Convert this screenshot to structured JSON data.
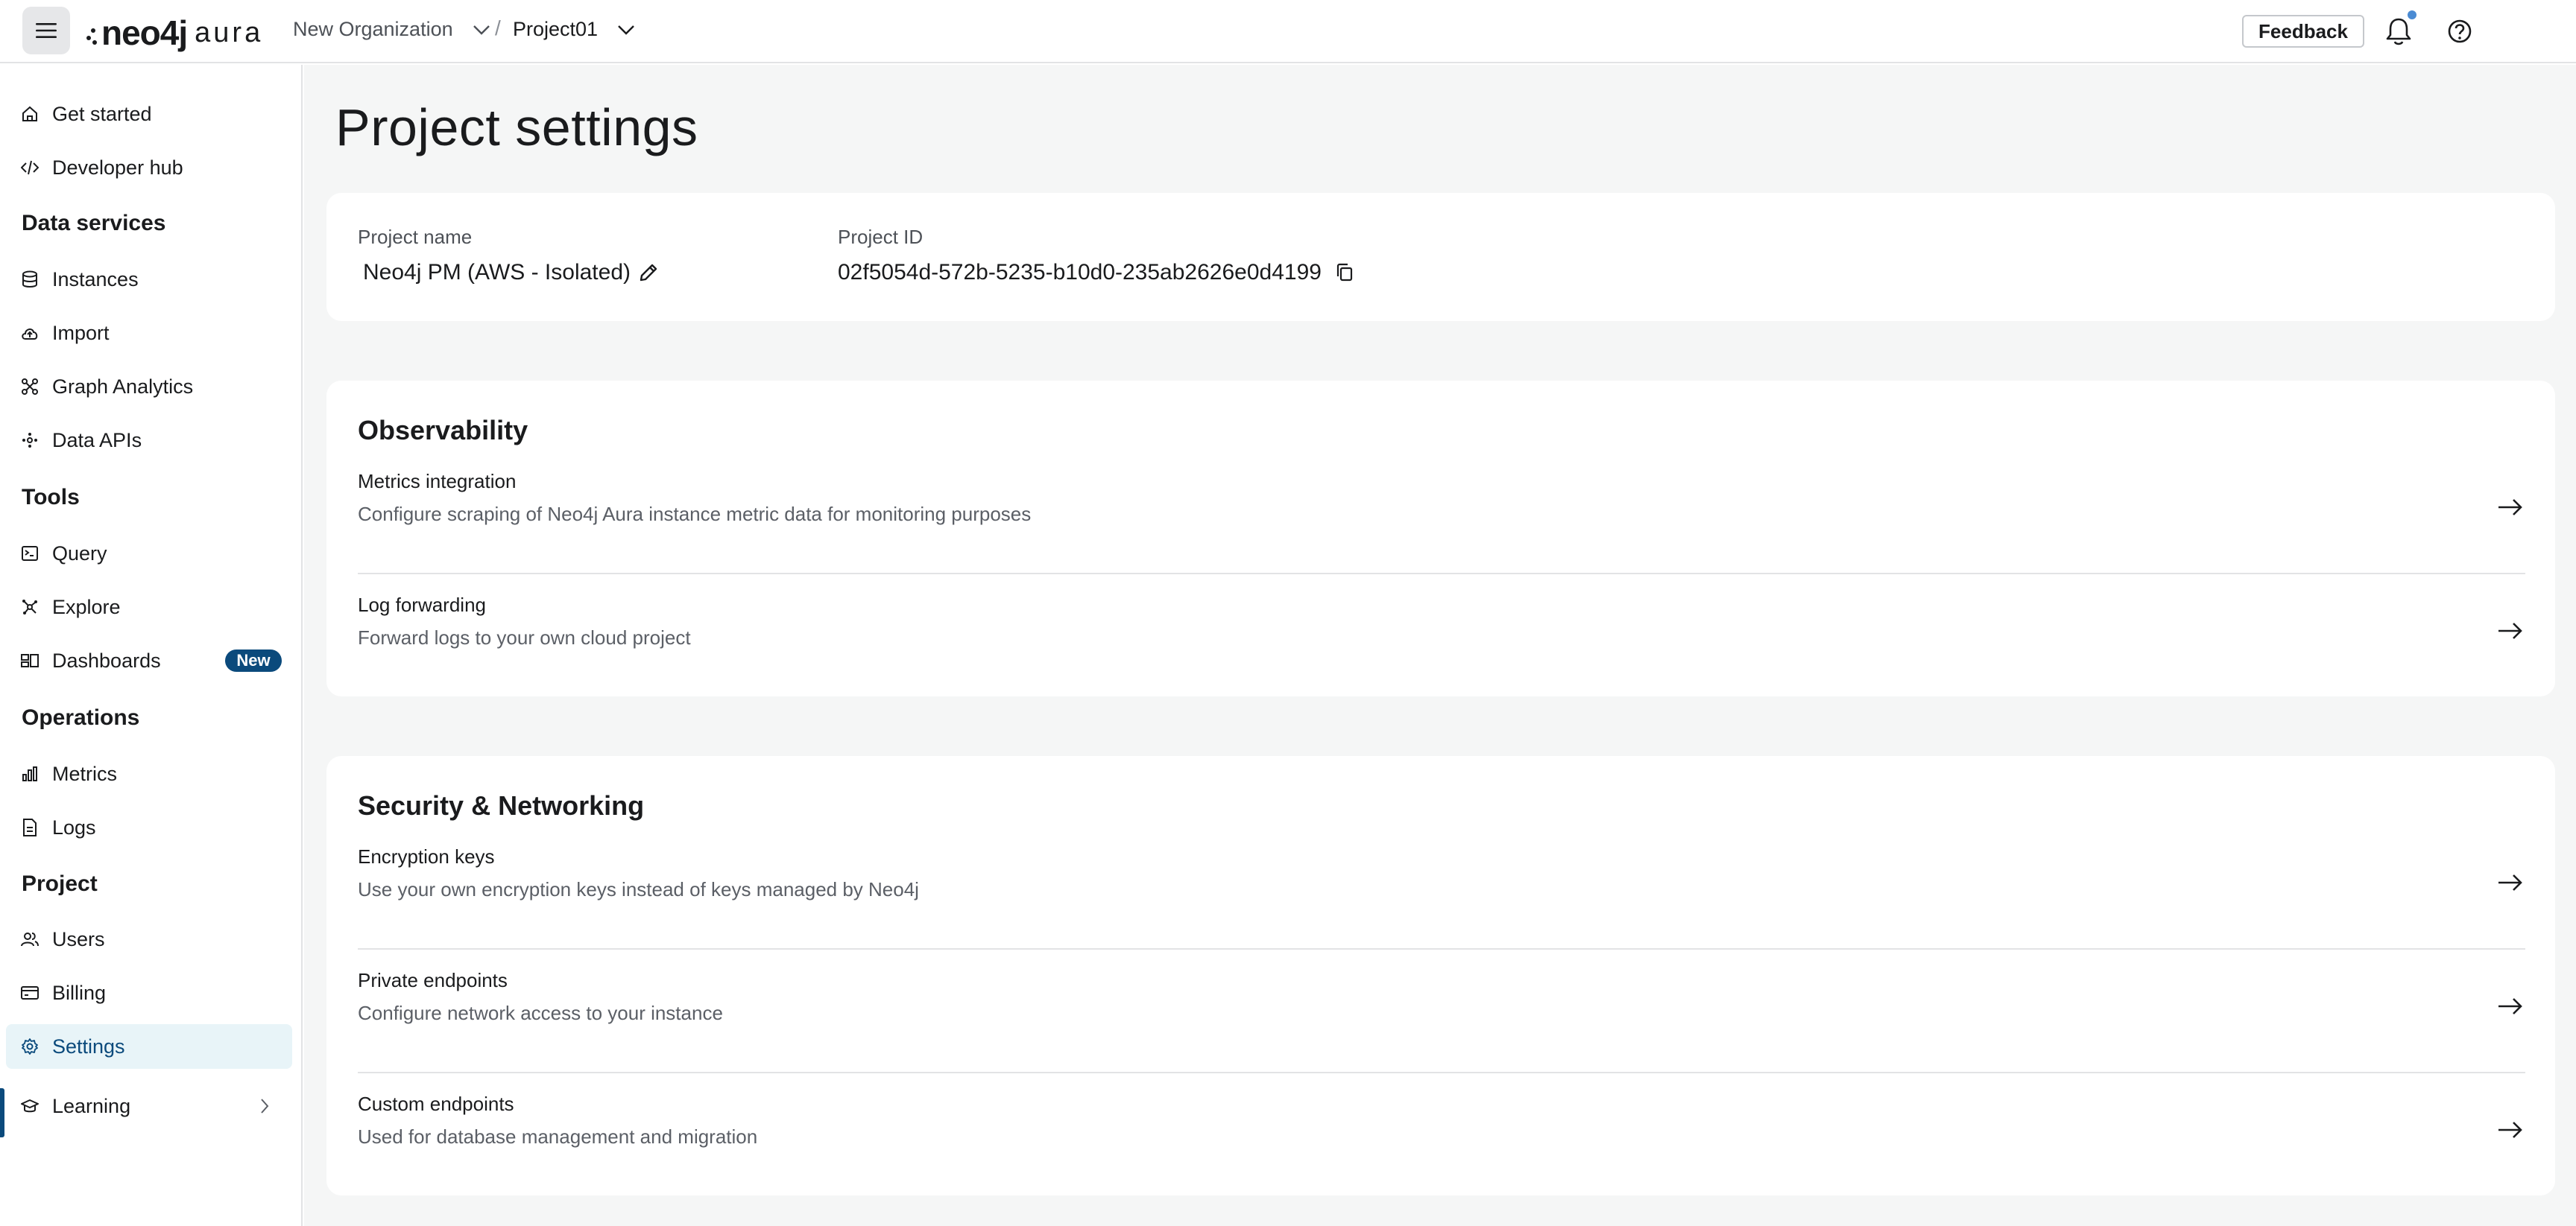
{
  "topbar": {
    "logo_main": "neo4j",
    "logo_sub": "aura",
    "organization": "New Organization",
    "separator": "/",
    "project": "Project01",
    "feedback_label": "Feedback",
    "icons": [
      "menu-icon",
      "chevron-down-icon",
      "bell-icon",
      "help-icon"
    ],
    "notification_dot_color": "#4b8bd3"
  },
  "sidebar": {
    "top_items": [
      {
        "label": "Get started",
        "icon": "home-icon"
      },
      {
        "label": "Developer hub",
        "icon": "code-icon"
      }
    ],
    "sections": [
      {
        "title": "Data services",
        "items": [
          {
            "label": "Instances",
            "icon": "database-icon"
          },
          {
            "label": "Import",
            "icon": "cloud-upload-icon"
          },
          {
            "label": "Graph Analytics",
            "icon": "graph-analytics-icon"
          },
          {
            "label": "Data APIs",
            "icon": "data-api-icon"
          }
        ]
      },
      {
        "title": "Tools",
        "items": [
          {
            "label": "Query",
            "icon": "query-icon"
          },
          {
            "label": "Explore",
            "icon": "explore-icon"
          },
          {
            "label": "Dashboards",
            "icon": "dashboard-icon",
            "badge": "New"
          }
        ]
      },
      {
        "title": "Operations",
        "items": [
          {
            "label": "Metrics",
            "icon": "bar-chart-icon"
          },
          {
            "label": "Logs",
            "icon": "document-icon"
          }
        ]
      },
      {
        "title": "Project",
        "items": [
          {
            "label": "Users",
            "icon": "users-icon"
          },
          {
            "label": "Billing",
            "icon": "credit-card-icon"
          },
          {
            "label": "Settings",
            "icon": "gear-icon",
            "active": true
          }
        ]
      }
    ],
    "learning": {
      "label": "Learning",
      "icon": "graduation-cap-icon"
    },
    "accent_color": "#0b4a7c",
    "active_bg": "#e8f4f8"
  },
  "main": {
    "title": "Project settings",
    "project_card": {
      "name_label": "Project name",
      "name_value": "Neo4j PM (AWS - Isolated)",
      "id_label": "Project ID",
      "id_value": "02f5054d-572b-5235-b10d0-235ab2626e0d4199"
    },
    "observability": {
      "title": "Observability",
      "rows": [
        {
          "title": "Metrics integration",
          "description": "Configure scraping of Neo4j Aura instance metric data for monitoring purposes"
        },
        {
          "title": "Log forwarding",
          "description": "Forward logs to your own cloud project"
        }
      ]
    },
    "security": {
      "title": "Security & Networking",
      "rows": [
        {
          "title": "Encryption keys",
          "description": "Use your own encryption keys instead of keys managed by Neo4j"
        },
        {
          "title": "Private endpoints",
          "description": "Configure network access to your instance"
        },
        {
          "title": "Custom endpoints",
          "description": "Used for database management and migration"
        }
      ]
    }
  }
}
